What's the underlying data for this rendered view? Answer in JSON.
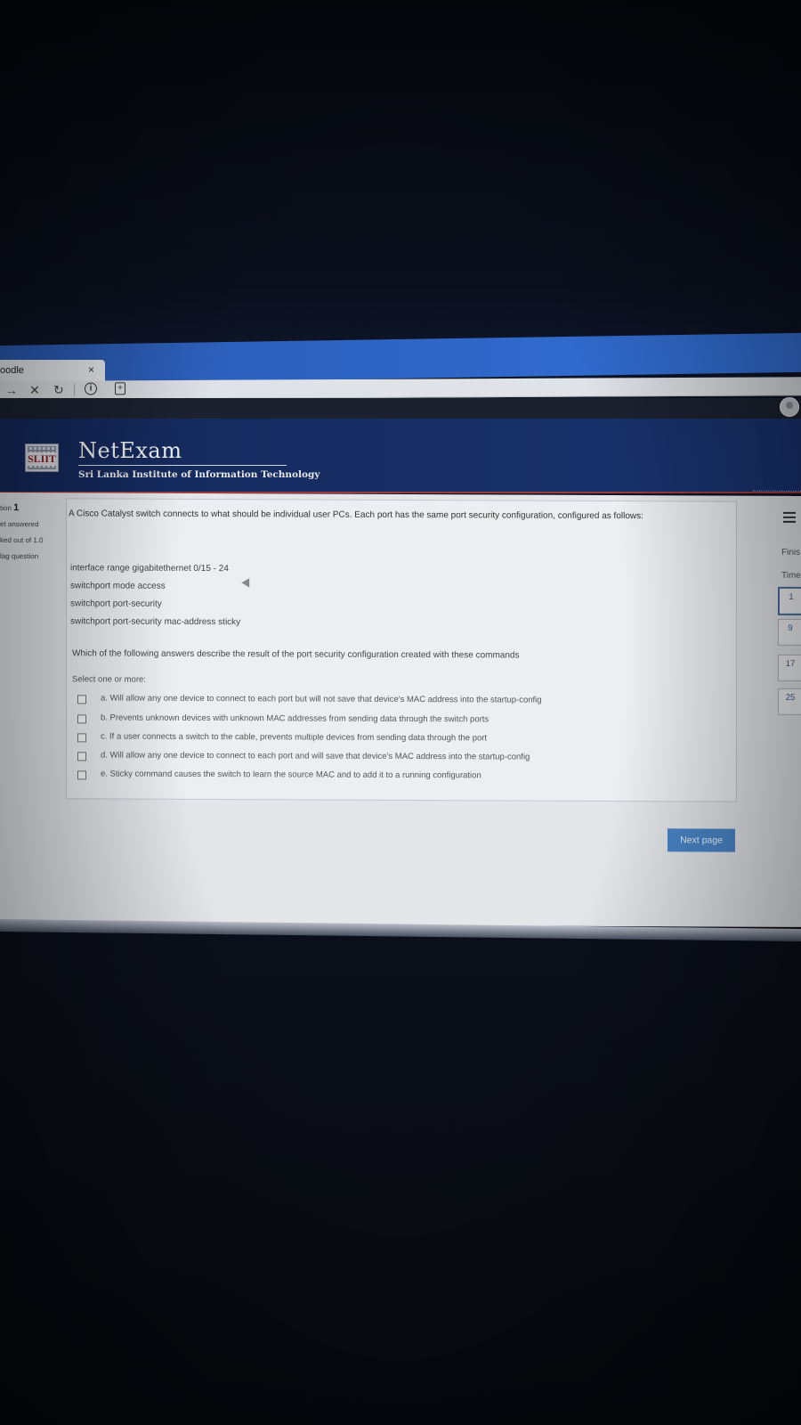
{
  "browser": {
    "tab_title": "oodle",
    "tab_close": "×",
    "nav": {
      "forward": "→",
      "stop": "✕",
      "reload": "↻"
    },
    "info_icon_glyph": "i",
    "ext_icon_glyph": "+"
  },
  "header": {
    "brand": "NetExam",
    "subtitle": "Sri Lanka Institute of Information Technology",
    "logo_text": "SLIIT"
  },
  "question_info": {
    "prefix": "tion",
    "number": "1",
    "status": "et answered",
    "marks": "ked out of 1.0",
    "flag": "lag question"
  },
  "question": {
    "text": "A Cisco Catalyst switch connects to what should be individual user PCs. Each port has the same port security configuration, configured as follows:",
    "config_lines": [
      "interface range gigabitethernet 0/15 - 24",
      "switchport mode access",
      "switchport port-security",
      "switchport port-security mac-address sticky"
    ],
    "prompt": "Which of the following answers describe the result of the port security configuration created with these commands",
    "select_label": "Select one or more:",
    "options": [
      "a. Will allow any one device to connect to each port but will not save that device's MAC address into the startup-config",
      "b. Prevents unknown devices with unknown MAC addresses from sending data through the switch ports",
      "c. If a user connects a switch to the cable, prevents multiple devices from sending data through the port",
      "d. Will allow any one device to connect to each port and will save that device's MAC address into the startup-config",
      "e. Sticky command causes the switch to learn the source MAC and to add it to a running configuration"
    ]
  },
  "next_button": "Next page",
  "quiz_nav": {
    "finish_label": "Finis",
    "time_label": "Time",
    "pages": [
      "1",
      "9",
      "17",
      "25"
    ]
  },
  "colors": {
    "header_bg": "#172e66",
    "accent_button": "#4a86c8",
    "browser_band": "#2f67c9"
  }
}
